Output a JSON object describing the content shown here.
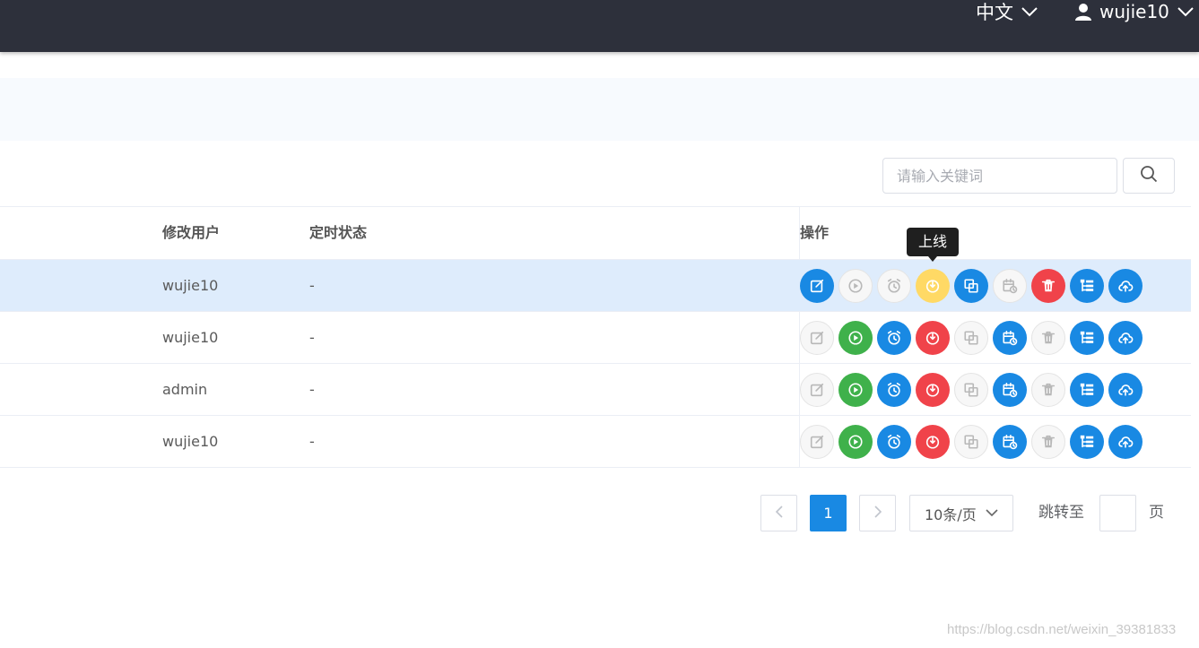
{
  "header": {
    "language": "中文",
    "username": "wujie10"
  },
  "search": {
    "placeholder": "请输入关键词",
    "value": ""
  },
  "table": {
    "columns": {
      "user": "修改用户",
      "schedule": "定时状态",
      "actions": "操作"
    },
    "rows": [
      {
        "user": "wujie10",
        "schedule": "-"
      },
      {
        "user": "wujie10",
        "schedule": "-"
      },
      {
        "user": "admin",
        "schedule": "-"
      },
      {
        "user": "wujie10",
        "schedule": "-"
      }
    ]
  },
  "tooltip": {
    "text": "上线"
  },
  "action_icons": [
    "edit-icon",
    "play-icon",
    "alarm-icon",
    "power-icon",
    "copy-icon",
    "calendar-clock-icon",
    "trash-icon",
    "tree-icon",
    "cloud-upload-icon"
  ],
  "colors": {
    "blue": "#1989e3",
    "green": "#3fb14b",
    "red": "#f0434a",
    "yellow": "#ffd965",
    "header_bg": "#2d303b",
    "selected_row": "#deecfc"
  },
  "pagination": {
    "current_page": "1",
    "page_size": "10条/页",
    "jump_label": "跳转至",
    "page_suffix": "页",
    "jump_value": ""
  },
  "watermark": "https://blog.csdn.net/weixin_39381833"
}
